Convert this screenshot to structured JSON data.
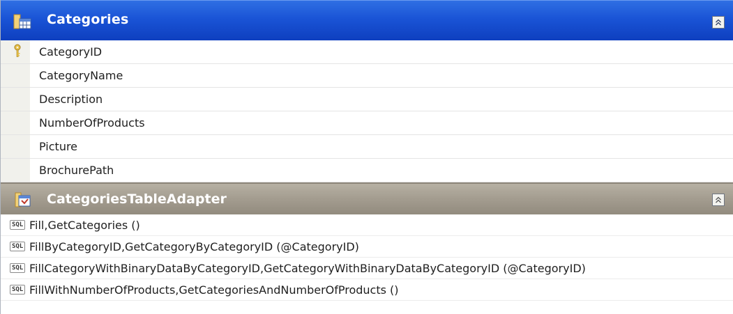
{
  "table": {
    "title": "Categories",
    "collapse_glyph": "⌃",
    "columns": [
      {
        "name": "CategoryID",
        "is_key": true
      },
      {
        "name": "CategoryName",
        "is_key": false
      },
      {
        "name": "Description",
        "is_key": false
      },
      {
        "name": "NumberOfProducts",
        "is_key": false
      },
      {
        "name": "Picture",
        "is_key": false
      },
      {
        "name": "BrochurePath",
        "is_key": false
      }
    ]
  },
  "adapter": {
    "title": "CategoriesTableAdapter",
    "collapse_glyph": "⌃",
    "queries": [
      {
        "icon_text": "SQL",
        "label": "Fill,GetCategories ()"
      },
      {
        "icon_text": "SQL",
        "label": "FillByCategoryID,GetCategoryByCategoryID (@CategoryID)"
      },
      {
        "icon_text": "SQL",
        "label": "FillCategoryWithBinaryDataByCategoryID,GetCategoryWithBinaryDataByCategoryID (@CategoryID)"
      },
      {
        "icon_text": "SQL",
        "label": "FillWithNumberOfProducts,GetCategoriesAndNumberOfProducts ()"
      }
    ]
  },
  "colors": {
    "table_header": "#1a54d6",
    "adapter_header": "#a39c8f",
    "row_gutter": "#f1f1ec"
  },
  "icons": {
    "table_icon": "table-icon",
    "key_icon": "key-icon",
    "adapter_icon": "table-adapter-icon",
    "query_icon": "sql-query-icon",
    "collapse_icon": "collapse-icon"
  }
}
